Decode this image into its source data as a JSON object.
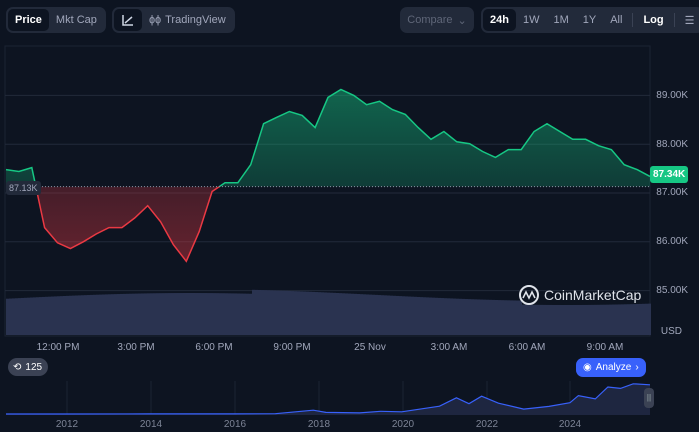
{
  "toolbar": {
    "price": "Price",
    "mkt_cap": "Mkt Cap",
    "line_icon": "line-chart-icon",
    "tradingview": "TradingView",
    "compare": "Compare",
    "ranges": [
      "24h",
      "1W",
      "1M",
      "1Y",
      "All"
    ],
    "active_range": "24h",
    "log": "Log",
    "settings_icon": "sliders-icon"
  },
  "watermark": "CoinMarketCap",
  "badges": {
    "open": "87.13K",
    "current": "87.34K",
    "history_count": "125",
    "analyze": "Analyze"
  },
  "colors": {
    "up": "#16c784",
    "down": "#ea3943",
    "current_badge": "#16c784",
    "analyze": "#3861fb",
    "volume": "#2a3350",
    "mini_line": "#3861fb"
  },
  "chart_data": [
    {
      "type": "area",
      "ylim": [
        84.7,
        89.9
      ],
      "y_ticks": [
        "89.00K",
        "88.00K",
        "87.00K",
        "86.00K",
        "85.00K"
      ],
      "y_unit": "USD",
      "x_ticks": [
        "12:00 PM",
        "3:00 PM",
        "6:00 PM",
        "9:00 PM",
        "25 Nov",
        "3:00 AM",
        "6:00 AM",
        "9:00 AM"
      ],
      "baseline": 87.13,
      "last": 87.34,
      "x": [
        "10:00",
        "10:30",
        "11:00",
        "11:30",
        "12:00",
        "12:30",
        "13:00",
        "13:30",
        "14:00",
        "14:30",
        "15:00",
        "15:30",
        "16:00",
        "16:30",
        "17:00",
        "17:30",
        "18:00",
        "18:30",
        "19:00",
        "19:30",
        "20:00",
        "20:30",
        "21:00",
        "21:30",
        "22:00",
        "22:30",
        "23:00",
        "23:30",
        "00:00",
        "00:30",
        "01:00",
        "01:30",
        "02:00",
        "02:30",
        "03:00",
        "03:30",
        "04:00",
        "04:30",
        "05:00",
        "05:30",
        "06:00",
        "06:30",
        "07:00",
        "07:30",
        "08:00",
        "08:30",
        "09:00",
        "09:30",
        "10:00",
        "10:30",
        "10:45"
      ],
      "values": [
        87.48,
        87.44,
        87.52,
        86.29,
        85.98,
        85.86,
        86.0,
        86.16,
        86.29,
        86.29,
        86.49,
        86.74,
        86.41,
        85.94,
        85.6,
        86.21,
        87.03,
        87.21,
        87.21,
        87.58,
        88.42,
        88.55,
        88.67,
        88.59,
        88.34,
        88.96,
        89.12,
        89.0,
        88.81,
        88.88,
        88.71,
        88.61,
        88.34,
        88.1,
        88.26,
        88.05,
        88.01,
        87.85,
        87.73,
        87.89,
        87.89,
        88.26,
        88.42,
        88.26,
        88.1,
        88.1,
        87.97,
        87.89,
        87.58,
        87.48,
        87.34
      ]
    },
    {
      "type": "area",
      "x_ticks": [
        "2012",
        "2014",
        "2016",
        "2018",
        "2020",
        "2022",
        "2024"
      ],
      "x": [
        2010.6,
        2012,
        2014,
        2016,
        2017,
        2017.9,
        2018.2,
        2019,
        2019.5,
        2020,
        2020.9,
        2021.3,
        2021.6,
        2021.9,
        2022.3,
        2022.9,
        2023.5,
        2024,
        2024.2,
        2024.6,
        2024.9,
        2025.2,
        2025.5,
        2025.9
      ],
      "values": [
        0,
        0,
        0.5,
        0.4,
        1,
        14,
        6,
        4,
        10,
        8,
        29,
        60,
        38,
        66,
        40,
        18,
        28,
        42,
        68,
        56,
        100,
        95,
        112,
        108
      ]
    }
  ]
}
